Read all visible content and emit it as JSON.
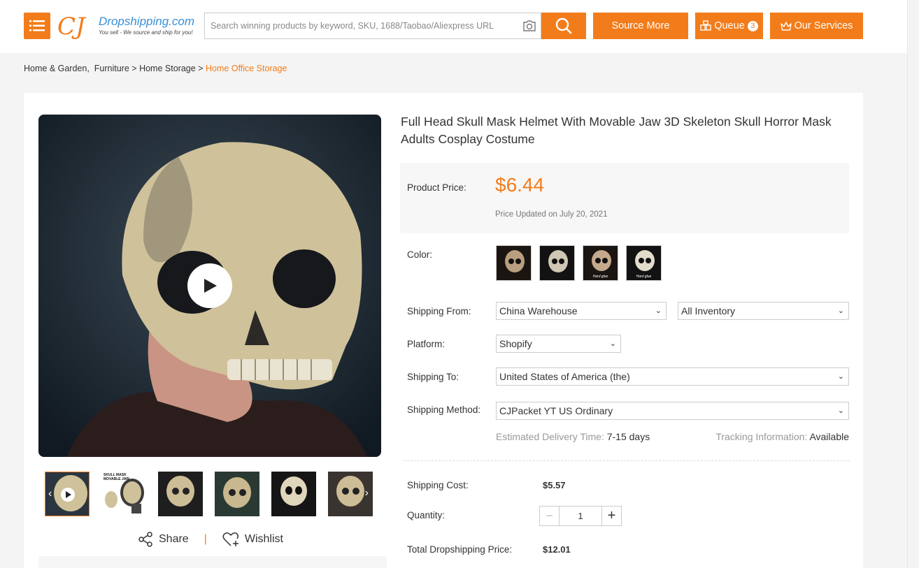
{
  "header": {
    "logo_mark": "CJ",
    "logo_brand": "Dropshipping.com",
    "logo_tagline": "You sell - We source and ship for you!",
    "search_placeholder": "Search winning products by keyword, SKU, 1688/Taobao/Aliexpress URL",
    "source_more": "Source More",
    "queue_label": "Queue",
    "queue_count": "3",
    "services_label": "Our Services",
    "accent_color": "#f37c1a"
  },
  "breadcrumb": {
    "items": [
      "Home & Garden",
      "Furniture",
      "Home Storage"
    ],
    "separators": [
      ",",
      ">",
      ">"
    ],
    "current": "Home Office Storage"
  },
  "product": {
    "title": "Full Head Skull Mask Helmet With Movable Jaw 3D Skeleton Skull Horror Mask Adults Cosplay Costume",
    "price_label": "Product Price:",
    "price": "$6.44",
    "price_updated": "Price Updated on July 20, 2021",
    "color_label": "Color:",
    "swatch_captions": [
      "",
      "",
      "Hard glue",
      "Hard glue"
    ],
    "shipping_from_label": "Shipping From:",
    "shipping_from": "China Warehouse",
    "inventory": "All Inventory",
    "platform_label": "Platform:",
    "platform": "Shopify",
    "shipping_to_label": "Shipping To:",
    "shipping_to": "United States of America (the)",
    "shipping_method_label": "Shipping Method:",
    "shipping_method": "CJPacket YT US Ordinary",
    "delivery_label": "Estimated Delivery Time:",
    "delivery_value": "7-15 days",
    "tracking_label": "Tracking Information:",
    "tracking_value": "Available",
    "shipping_cost_label": "Shipping Cost:",
    "shipping_cost": "$5.57",
    "quantity_label": "Quantity:",
    "quantity": "1",
    "total_label": "Total Dropshipping Price:",
    "total": "$12.01"
  },
  "gallery": {
    "thumb2_caption_line1": "SKULL MASK",
    "thumb2_caption_line2": "MOVABLE JAW",
    "share_label": "Share",
    "separator": "|",
    "wishlist_label": "Wishlist"
  }
}
